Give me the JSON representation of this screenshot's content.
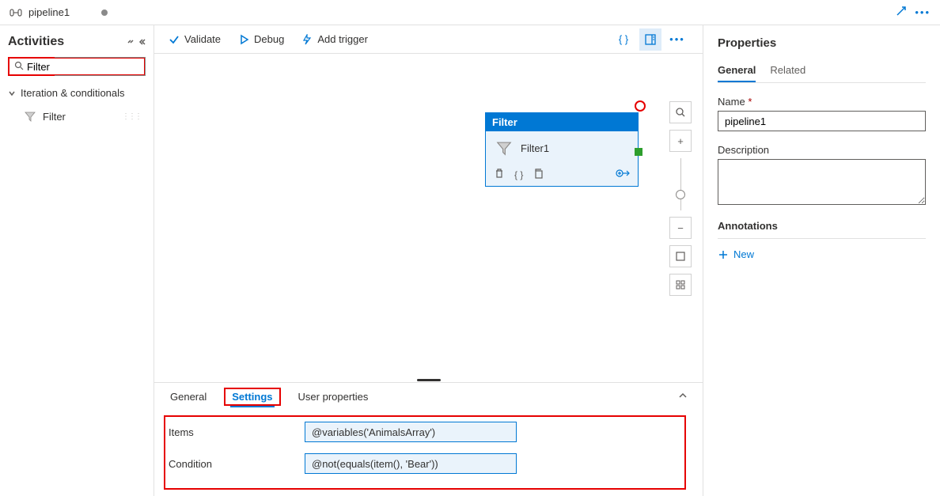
{
  "header": {
    "tab_title": "pipeline1"
  },
  "sidebar": {
    "title": "Activities",
    "search_value": "Filter",
    "category": "Iteration & conditionals",
    "activity": "Filter"
  },
  "toolbar": {
    "validate": "Validate",
    "debug": "Debug",
    "add_trigger": "Add trigger"
  },
  "node": {
    "type": "Filter",
    "name": "Filter1"
  },
  "bottom": {
    "tabs": {
      "general": "General",
      "settings": "Settings",
      "user_props": "User properties"
    },
    "items_label": "Items",
    "items_value": "@variables('AnimalsArray')",
    "condition_label": "Condition",
    "condition_value": "@not(equals(item(), 'Bear'))"
  },
  "properties": {
    "title": "Properties",
    "tabs": {
      "general": "General",
      "related": "Related"
    },
    "name_label": "Name",
    "name_value": "pipeline1",
    "description_label": "Description",
    "annotations_label": "Annotations",
    "new_label": "New"
  }
}
